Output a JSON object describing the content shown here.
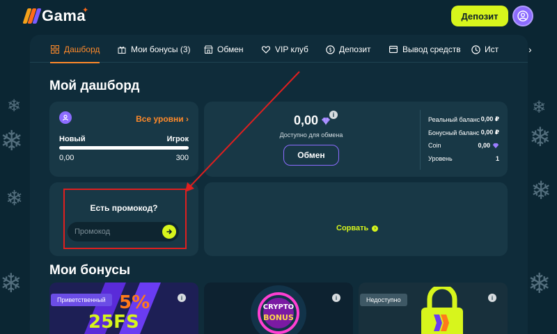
{
  "header": {
    "brand": "Gama",
    "deposit_label": "Депозит"
  },
  "tabs": [
    {
      "label": "Дашборд",
      "icon": "dashboard-icon",
      "active": true
    },
    {
      "label": "Мои бонусы (3)",
      "icon": "gift-icon",
      "active": false
    },
    {
      "label": "Обмен",
      "icon": "shop-icon",
      "active": false
    },
    {
      "label": "VIP клуб",
      "icon": "heart-icon",
      "active": false
    },
    {
      "label": "Депозит",
      "icon": "coins-icon",
      "active": false
    },
    {
      "label": "Вывод средств",
      "icon": "withdraw-icon",
      "active": false
    },
    {
      "label": "Ист",
      "icon": "history-icon",
      "active": false
    }
  ],
  "dashboard": {
    "title": "Мой дашборд",
    "level": {
      "all_levels_label": "Все уровни",
      "current_level": "Новый",
      "next_level": "Игрок",
      "points_current": "0,00",
      "points_target": "300",
      "progress": 0
    },
    "balance": {
      "amount": "0,00",
      "caption": "Доступно для обмена",
      "exchange_label": "Обмен",
      "stats": [
        {
          "label": "Реальный баланс",
          "value": "0,00 ₽"
        },
        {
          "label": "Бонусный баланс",
          "value": "0,00 ₽"
        },
        {
          "label": "Coin",
          "value": "0,00"
        },
        {
          "label": "Уровень",
          "value": "1"
        }
      ]
    },
    "promo": {
      "title": "Есть промокод?",
      "placeholder": "Промокод",
      "value": ""
    },
    "reset_label": "Сорвать"
  },
  "bonuses": {
    "title": "Мои бонусы",
    "cards": [
      {
        "badge": "Приветственный",
        "line1": "5%",
        "line2": "25FS"
      },
      {
        "badge": "",
        "line1": "CRYPTO",
        "line2": "BONUS"
      },
      {
        "badge": "Недоступно",
        "line1": "",
        "line2": ""
      }
    ]
  },
  "colors": {
    "accent_orange": "#ff8a2a",
    "accent_lime": "#d7f51c",
    "accent_purple": "#8c6cff",
    "annotation_red": "#e01f1f"
  }
}
